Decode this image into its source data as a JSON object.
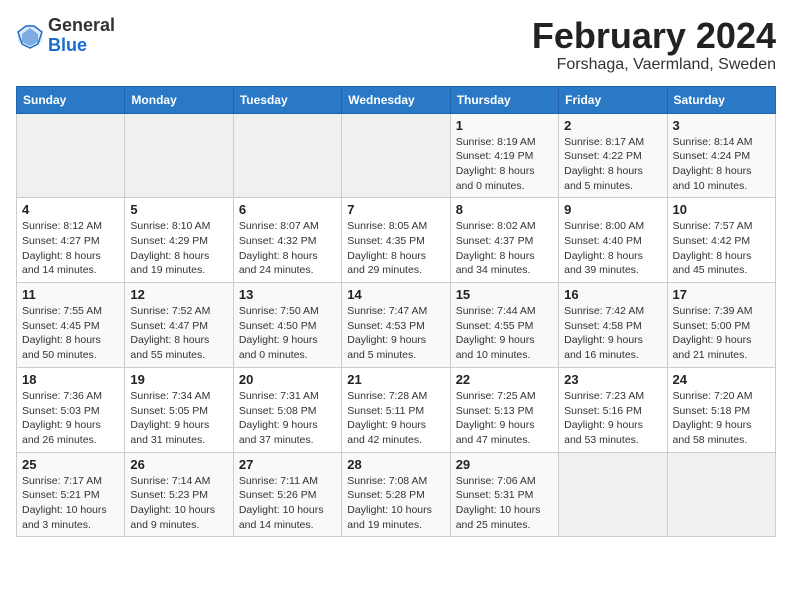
{
  "logo": {
    "general": "General",
    "blue": "Blue"
  },
  "title": "February 2024",
  "subtitle": "Forshaga, Vaermland, Sweden",
  "days_of_week": [
    "Sunday",
    "Monday",
    "Tuesday",
    "Wednesday",
    "Thursday",
    "Friday",
    "Saturday"
  ],
  "weeks": [
    [
      {
        "day": "",
        "info": ""
      },
      {
        "day": "",
        "info": ""
      },
      {
        "day": "",
        "info": ""
      },
      {
        "day": "",
        "info": ""
      },
      {
        "day": "1",
        "info": "Sunrise: 8:19 AM\nSunset: 4:19 PM\nDaylight: 8 hours\nand 0 minutes."
      },
      {
        "day": "2",
        "info": "Sunrise: 8:17 AM\nSunset: 4:22 PM\nDaylight: 8 hours\nand 5 minutes."
      },
      {
        "day": "3",
        "info": "Sunrise: 8:14 AM\nSunset: 4:24 PM\nDaylight: 8 hours\nand 10 minutes."
      }
    ],
    [
      {
        "day": "4",
        "info": "Sunrise: 8:12 AM\nSunset: 4:27 PM\nDaylight: 8 hours\nand 14 minutes."
      },
      {
        "day": "5",
        "info": "Sunrise: 8:10 AM\nSunset: 4:29 PM\nDaylight: 8 hours\nand 19 minutes."
      },
      {
        "day": "6",
        "info": "Sunrise: 8:07 AM\nSunset: 4:32 PM\nDaylight: 8 hours\nand 24 minutes."
      },
      {
        "day": "7",
        "info": "Sunrise: 8:05 AM\nSunset: 4:35 PM\nDaylight: 8 hours\nand 29 minutes."
      },
      {
        "day": "8",
        "info": "Sunrise: 8:02 AM\nSunset: 4:37 PM\nDaylight: 8 hours\nand 34 minutes."
      },
      {
        "day": "9",
        "info": "Sunrise: 8:00 AM\nSunset: 4:40 PM\nDaylight: 8 hours\nand 39 minutes."
      },
      {
        "day": "10",
        "info": "Sunrise: 7:57 AM\nSunset: 4:42 PM\nDaylight: 8 hours\nand 45 minutes."
      }
    ],
    [
      {
        "day": "11",
        "info": "Sunrise: 7:55 AM\nSunset: 4:45 PM\nDaylight: 8 hours\nand 50 minutes."
      },
      {
        "day": "12",
        "info": "Sunrise: 7:52 AM\nSunset: 4:47 PM\nDaylight: 8 hours\nand 55 minutes."
      },
      {
        "day": "13",
        "info": "Sunrise: 7:50 AM\nSunset: 4:50 PM\nDaylight: 9 hours\nand 0 minutes."
      },
      {
        "day": "14",
        "info": "Sunrise: 7:47 AM\nSunset: 4:53 PM\nDaylight: 9 hours\nand 5 minutes."
      },
      {
        "day": "15",
        "info": "Sunrise: 7:44 AM\nSunset: 4:55 PM\nDaylight: 9 hours\nand 10 minutes."
      },
      {
        "day": "16",
        "info": "Sunrise: 7:42 AM\nSunset: 4:58 PM\nDaylight: 9 hours\nand 16 minutes."
      },
      {
        "day": "17",
        "info": "Sunrise: 7:39 AM\nSunset: 5:00 PM\nDaylight: 9 hours\nand 21 minutes."
      }
    ],
    [
      {
        "day": "18",
        "info": "Sunrise: 7:36 AM\nSunset: 5:03 PM\nDaylight: 9 hours\nand 26 minutes."
      },
      {
        "day": "19",
        "info": "Sunrise: 7:34 AM\nSunset: 5:05 PM\nDaylight: 9 hours\nand 31 minutes."
      },
      {
        "day": "20",
        "info": "Sunrise: 7:31 AM\nSunset: 5:08 PM\nDaylight: 9 hours\nand 37 minutes."
      },
      {
        "day": "21",
        "info": "Sunrise: 7:28 AM\nSunset: 5:11 PM\nDaylight: 9 hours\nand 42 minutes."
      },
      {
        "day": "22",
        "info": "Sunrise: 7:25 AM\nSunset: 5:13 PM\nDaylight: 9 hours\nand 47 minutes."
      },
      {
        "day": "23",
        "info": "Sunrise: 7:23 AM\nSunset: 5:16 PM\nDaylight: 9 hours\nand 53 minutes."
      },
      {
        "day": "24",
        "info": "Sunrise: 7:20 AM\nSunset: 5:18 PM\nDaylight: 9 hours\nand 58 minutes."
      }
    ],
    [
      {
        "day": "25",
        "info": "Sunrise: 7:17 AM\nSunset: 5:21 PM\nDaylight: 10 hours\nand 3 minutes."
      },
      {
        "day": "26",
        "info": "Sunrise: 7:14 AM\nSunset: 5:23 PM\nDaylight: 10 hours\nand 9 minutes."
      },
      {
        "day": "27",
        "info": "Sunrise: 7:11 AM\nSunset: 5:26 PM\nDaylight: 10 hours\nand 14 minutes."
      },
      {
        "day": "28",
        "info": "Sunrise: 7:08 AM\nSunset: 5:28 PM\nDaylight: 10 hours\nand 19 minutes."
      },
      {
        "day": "29",
        "info": "Sunrise: 7:06 AM\nSunset: 5:31 PM\nDaylight: 10 hours\nand 25 minutes."
      },
      {
        "day": "",
        "info": ""
      },
      {
        "day": "",
        "info": ""
      }
    ]
  ]
}
